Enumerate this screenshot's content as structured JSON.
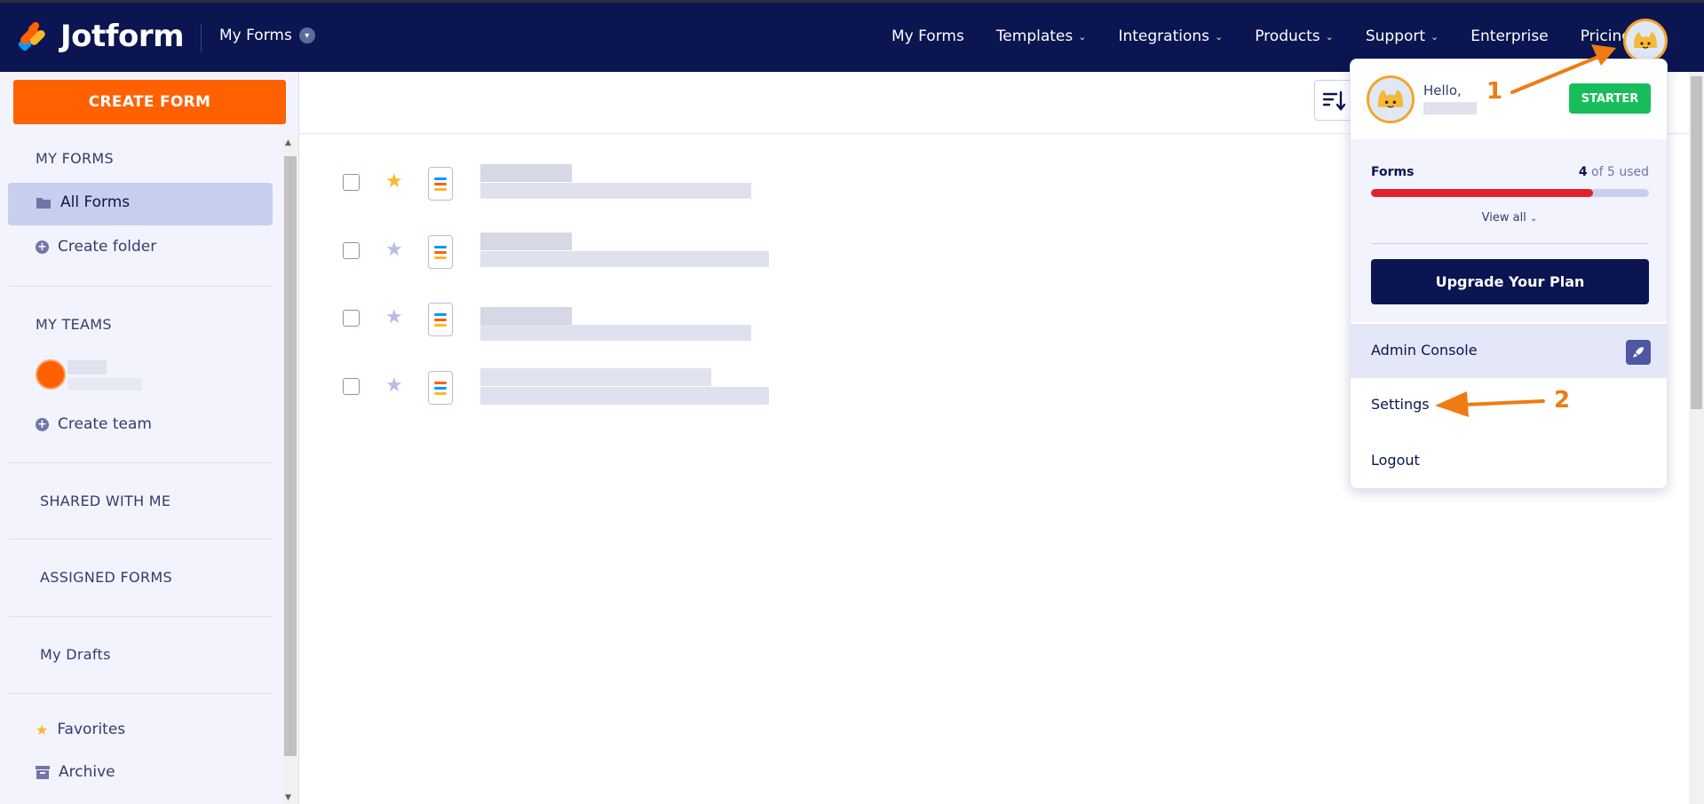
{
  "header": {
    "brand": "Jotform",
    "section_title": "My Forms",
    "nav": [
      {
        "label": "My Forms",
        "has_dropdown": false
      },
      {
        "label": "Templates",
        "has_dropdown": true
      },
      {
        "label": "Integrations",
        "has_dropdown": true
      },
      {
        "label": "Products",
        "has_dropdown": true
      },
      {
        "label": "Support",
        "has_dropdown": true
      },
      {
        "label": "Enterprise",
        "has_dropdown": false
      },
      {
        "label": "Pricing",
        "has_dropdown": false
      }
    ],
    "brand_colors": {
      "navy": "#0a1551",
      "orange": "#ff6100"
    }
  },
  "sidebar": {
    "create_button": "CREATE FORM",
    "my_forms_heading": "MY FORMS",
    "all_forms": "All Forms",
    "create_folder": "Create folder",
    "my_teams_heading": "MY TEAMS",
    "create_team": "Create team",
    "shared_with_me": "SHARED WITH ME",
    "assigned_forms": "ASSIGNED FORMS",
    "my_drafts": "My Drafts",
    "favorites": "Favorites",
    "archive": "Archive"
  },
  "forms": [
    {
      "starred": true,
      "icon": "form-icon"
    },
    {
      "starred": false,
      "icon": "form-icon"
    },
    {
      "starred": false,
      "icon": "form-icon"
    },
    {
      "starred": false,
      "icon": "card-form-icon"
    }
  ],
  "account_menu": {
    "greeting": "Hello,",
    "plan_badge": "STARTER",
    "usage": {
      "label": "Forms",
      "used": 4,
      "total": 5,
      "used_text": "4",
      "suffix_text": "of 5 used",
      "fill_fraction": 0.8,
      "view_all": "View all"
    },
    "upgrade_button": "Upgrade Your Plan",
    "admin_console": "Admin Console",
    "settings": "Settings",
    "logout": "Logout"
  },
  "annotations": {
    "step1": "1",
    "step2": "2",
    "color": "#f07b12"
  }
}
